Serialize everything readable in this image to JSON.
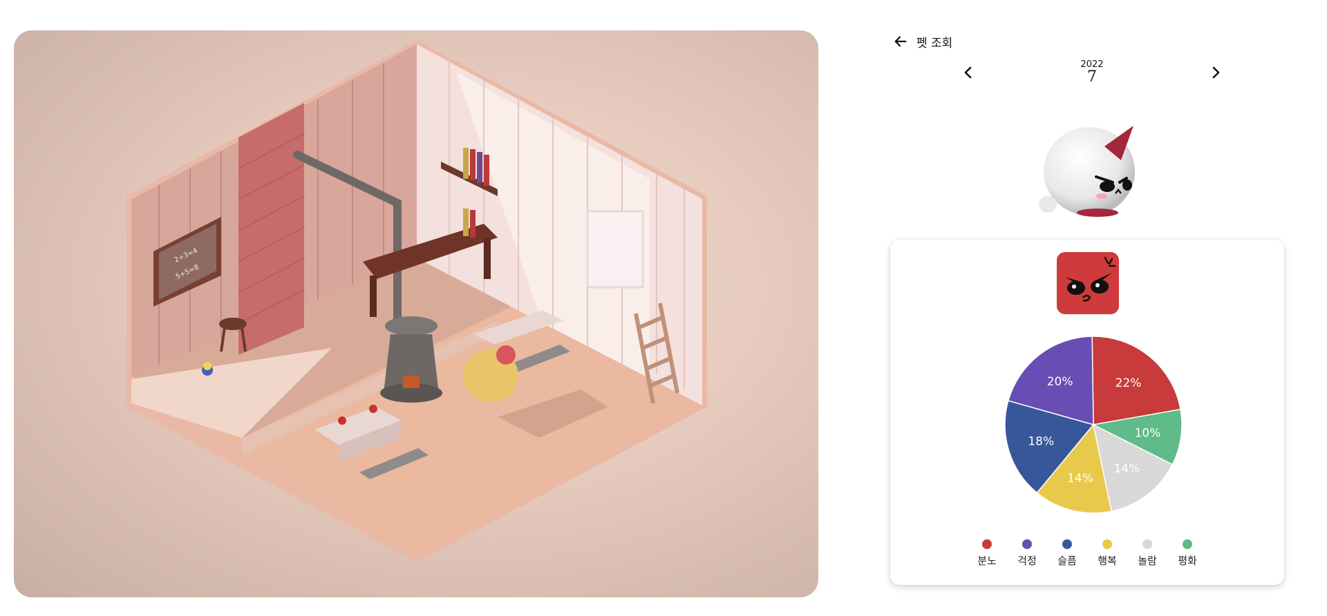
{
  "header": {
    "title": "펫 조회",
    "back_icon": "arrow-left-icon"
  },
  "month_nav": {
    "year": "2022",
    "month": "7",
    "prev_icon": "chevron-left-icon",
    "next_icon": "chevron-right-icon"
  },
  "pet": {
    "icon": "angry-unicorn-pet-icon"
  },
  "mood": {
    "icon": "angry-face-icon",
    "color": "#cf3b3c"
  },
  "chart_data": {
    "type": "pie",
    "start_angle_deg": 10,
    "direction": "counterclockwise",
    "slices": [
      {
        "name": "분노",
        "value": 22,
        "label": "22%",
        "color": "#c83a3b"
      },
      {
        "name": "걱정",
        "value": 20,
        "label": "20%",
        "color": "#684db4"
      },
      {
        "name": "슬픔",
        "value": 18,
        "label": "18%",
        "color": "#38579a"
      },
      {
        "name": "행복",
        "value": 14,
        "label": "14%",
        "color": "#e8c94c"
      },
      {
        "name": "놀람",
        "value": 14,
        "label": "14%",
        "color": "#d8d8d8"
      },
      {
        "name": "평화",
        "value": 10,
        "label": "10%",
        "color": "#5fbb88"
      }
    ],
    "legend_position": "bottom"
  },
  "scene": {
    "chalkboard_lines": [
      "2+3=4",
      "5+5=8"
    ]
  }
}
